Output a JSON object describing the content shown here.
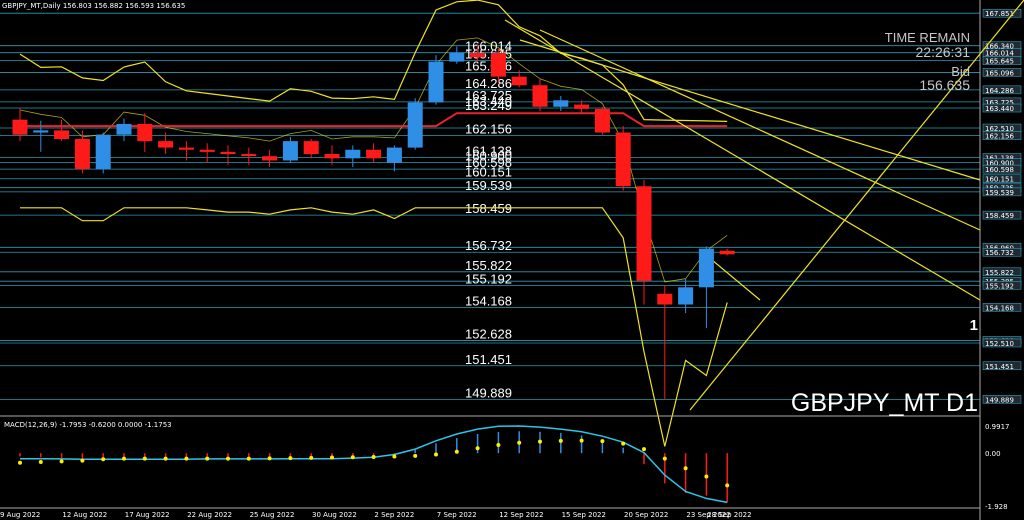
{
  "header": {
    "symbol_line": "GBPJPY_MT,Daily  156.803 156.882 156.593 156.635"
  },
  "overlay": {
    "time_remain_label": "TIME REMAIN",
    "time_remain_value": "22:26:31",
    "bid_label": "Bid",
    "bid_value": "156.635",
    "watermark": "GBPJPY_MT D1",
    "marker": "1"
  },
  "macd": {
    "label": "MACD(12,26,9) -1.7953 -0.6200 0.0000 -1.1753",
    "axis_labels": [
      "0.9917",
      "0.00",
      "-1.928"
    ]
  },
  "x_axis": {
    "labels": [
      "9 Aug 2022",
      "12 Aug 2022",
      "17 Aug 2022",
      "22 Aug 2022",
      "25 Aug 2022",
      "30 Aug 2022",
      "2 Sep 2022",
      "7 Sep 2022",
      "12 Sep 2022",
      "15 Sep 2022",
      "20 Sep 2022",
      "23 Sep 2022",
      "28 Sep 2022"
    ]
  },
  "colors": {
    "background": "#000000",
    "bull": "#2f8fe6",
    "bear": "#ff1a1a",
    "level_line": "#33b8d6",
    "yellow": "#f2e21d",
    "ma_red": "#e8242b",
    "macd_line": "#2ec4e6",
    "macd_signal": "#ffee00"
  },
  "chart_data": {
    "type": "candlestick",
    "symbol": "GBPJPY_MT",
    "timeframe": "Daily",
    "ylim": [
      149.3,
      168.0
    ],
    "price_levels": [
      167.851,
      166.34,
      166.014,
      165.645,
      165.096,
      164.286,
      163.725,
      163.44,
      162.51,
      162.156,
      161.138,
      160.9,
      160.598,
      160.151,
      159.735,
      159.539,
      158.459,
      156.96,
      156.732,
      155.822,
      155.385,
      155.192,
      154.168,
      152.628,
      152.51,
      151.451,
      149.889
    ],
    "right_axis_labels": [
      "167.851",
      "166.340",
      "166.014",
      "165.645",
      "165.096",
      "164.286",
      "163.725",
      "163.440",
      "162.510",
      "162.156",
      "161.138",
      "160.900",
      "160.598",
      "160.151",
      "159.735",
      "159.539",
      "158.459",
      "156.960",
      "156.732",
      "155.822",
      "155.385",
      "155.192",
      "154.168",
      "152.628",
      "152.510",
      "151.451",
      "149.889"
    ],
    "left_level_labels": [
      "163.249",
      "166.014",
      "165.645",
      "165.096",
      "164.286",
      "163.725",
      "163.440",
      "162.156",
      "161.138",
      "160.900",
      "160.598",
      "160.151",
      "159.539",
      "158.459",
      "156.732",
      "155.822",
      "155.192",
      "154.168",
      "152.628",
      "151.451",
      "149.889"
    ],
    "candles": [
      {
        "o": 162.9,
        "h": 163.45,
        "l": 161.9,
        "c": 162.2
      },
      {
        "o": 162.3,
        "h": 162.85,
        "l": 161.4,
        "c": 162.4
      },
      {
        "o": 162.4,
        "h": 162.9,
        "l": 161.9,
        "c": 162.0
      },
      {
        "o": 162.0,
        "h": 162.4,
        "l": 160.4,
        "c": 160.6
      },
      {
        "o": 160.6,
        "h": 162.3,
        "l": 160.4,
        "c": 162.2
      },
      {
        "o": 162.2,
        "h": 162.95,
        "l": 161.9,
        "c": 162.7
      },
      {
        "o": 162.7,
        "h": 163.2,
        "l": 161.4,
        "c": 161.9
      },
      {
        "o": 161.9,
        "h": 162.3,
        "l": 161.3,
        "c": 161.6
      },
      {
        "o": 161.6,
        "h": 161.9,
        "l": 161.0,
        "c": 161.5
      },
      {
        "o": 161.5,
        "h": 161.8,
        "l": 160.9,
        "c": 161.4
      },
      {
        "o": 161.4,
        "h": 161.7,
        "l": 160.8,
        "c": 161.3
      },
      {
        "o": 161.3,
        "h": 161.6,
        "l": 160.8,
        "c": 161.2
      },
      {
        "o": 161.2,
        "h": 161.5,
        "l": 160.7,
        "c": 161.0
      },
      {
        "o": 161.0,
        "h": 162.1,
        "l": 160.9,
        "c": 161.9
      },
      {
        "o": 161.9,
        "h": 162.0,
        "l": 161.1,
        "c": 161.3
      },
      {
        "o": 161.3,
        "h": 161.7,
        "l": 160.8,
        "c": 161.1
      },
      {
        "o": 161.1,
        "h": 161.7,
        "l": 160.7,
        "c": 161.5
      },
      {
        "o": 161.5,
        "h": 161.8,
        "l": 160.9,
        "c": 161.1
      },
      {
        "o": 160.9,
        "h": 161.7,
        "l": 160.5,
        "c": 161.6
      },
      {
        "o": 161.6,
        "h": 163.9,
        "l": 161.5,
        "c": 163.7
      },
      {
        "o": 163.7,
        "h": 165.9,
        "l": 163.6,
        "c": 165.6
      },
      {
        "o": 165.6,
        "h": 166.3,
        "l": 165.5,
        "c": 166.0
      },
      {
        "o": 166.0,
        "h": 166.4,
        "l": 165.6,
        "c": 165.8
      },
      {
        "o": 166.0,
        "h": 166.2,
        "l": 164.6,
        "c": 164.9
      },
      {
        "o": 164.9,
        "h": 165.2,
        "l": 164.4,
        "c": 164.5
      },
      {
        "o": 164.5,
        "h": 164.8,
        "l": 163.3,
        "c": 163.5
      },
      {
        "o": 163.5,
        "h": 164.0,
        "l": 163.3,
        "c": 163.8
      },
      {
        "o": 163.6,
        "h": 163.8,
        "l": 163.2,
        "c": 163.4
      },
      {
        "o": 163.4,
        "h": 163.5,
        "l": 162.2,
        "c": 162.3
      },
      {
        "o": 162.3,
        "h": 162.6,
        "l": 159.6,
        "c": 159.8
      },
      {
        "o": 159.8,
        "h": 160.1,
        "l": 154.3,
        "c": 155.4
      },
      {
        "o": 154.8,
        "h": 155.2,
        "l": 149.9,
        "c": 154.3
      },
      {
        "o": 154.3,
        "h": 155.5,
        "l": 153.9,
        "c": 155.1
      },
      {
        "o": 155.1,
        "h": 157.0,
        "l": 153.2,
        "c": 156.9
      },
      {
        "o": 156.803,
        "h": 156.882,
        "l": 156.593,
        "c": 156.635
      }
    ],
    "macd_series": {
      "histogram": [
        -0.12,
        -0.15,
        -0.18,
        -0.22,
        -0.2,
        -0.18,
        -0.2,
        -0.19,
        -0.18,
        -0.17,
        -0.16,
        -0.15,
        -0.14,
        -0.12,
        -0.12,
        -0.1,
        -0.1,
        -0.09,
        -0.05,
        0.12,
        0.36,
        0.55,
        0.7,
        0.77,
        0.8,
        0.78,
        0.74,
        0.65,
        0.5,
        0.2,
        -0.4,
        -1.1,
        -1.45,
        -1.55,
        -1.7953
      ],
      "signal": [
        -0.35,
        -0.32,
        -0.3,
        -0.27,
        -0.22,
        -0.2,
        -0.2,
        -0.2,
        -0.2,
        -0.2,
        -0.2,
        -0.2,
        -0.19,
        -0.18,
        -0.17,
        -0.16,
        -0.15,
        -0.14,
        -0.12,
        -0.1,
        -0.05,
        0.05,
        0.18,
        0.3,
        0.38,
        0.42,
        0.45,
        0.46,
        0.44,
        0.35,
        0.15,
        -0.2,
        -0.55,
        -0.85,
        -1.1753
      ],
      "line": [
        -0.2,
        -0.2,
        -0.21,
        -0.22,
        -0.22,
        -0.22,
        -0.22,
        -0.22,
        -0.22,
        -0.21,
        -0.21,
        -0.21,
        -0.21,
        -0.2,
        -0.2,
        -0.2,
        -0.18,
        -0.15,
        -0.05,
        0.15,
        0.45,
        0.7,
        0.88,
        0.98,
        0.99,
        0.95,
        0.88,
        0.78,
        0.62,
        0.4,
        0.02,
        -0.8,
        -1.4,
        -1.65,
        -1.7953
      ],
      "ylim": [
        -1.928,
        0.9917
      ]
    }
  }
}
